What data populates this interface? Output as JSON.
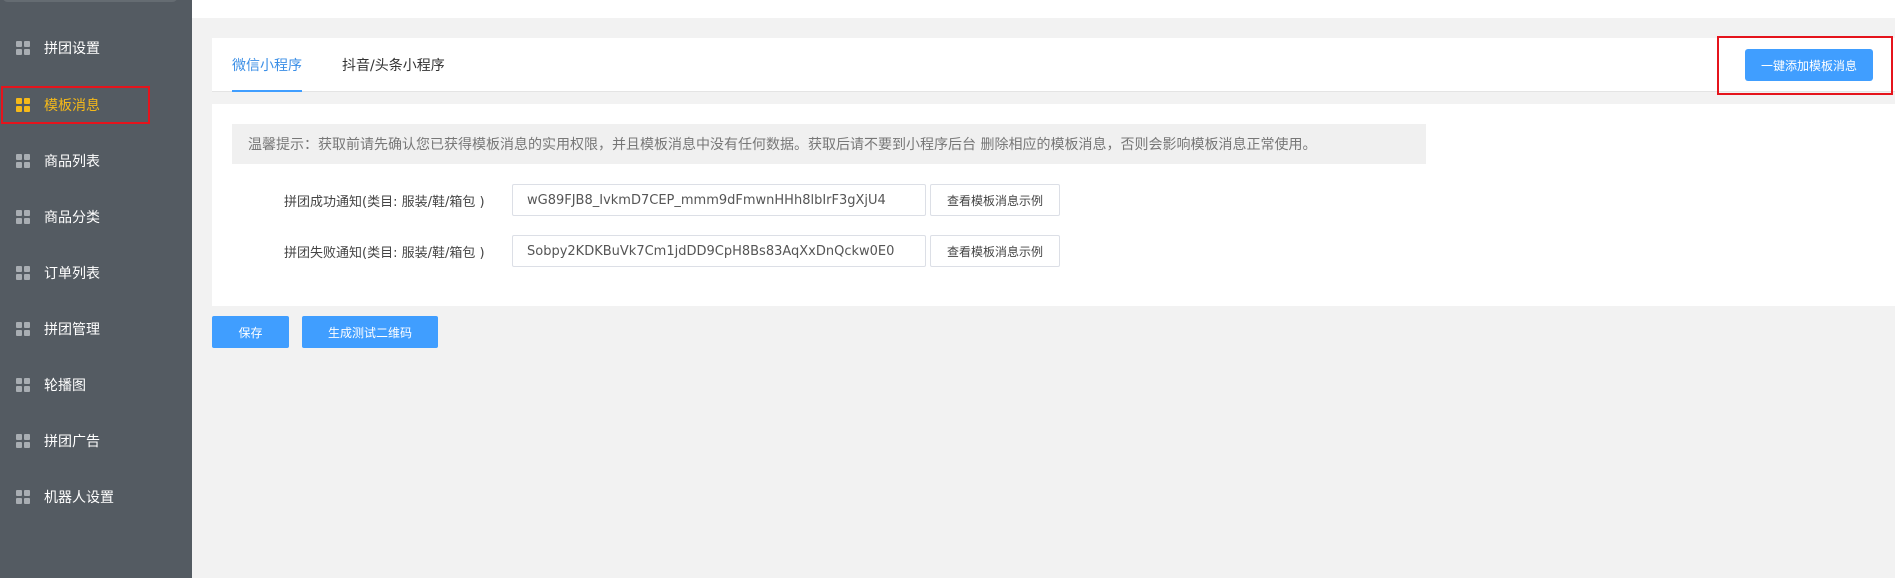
{
  "sidebar": {
    "items": [
      {
        "label": "拼团设置",
        "icon": "grid-icon",
        "active": false
      },
      {
        "label": "模板消息",
        "icon": "grid-icon",
        "active": true
      },
      {
        "label": "商品列表",
        "icon": "grid-icon",
        "active": false
      },
      {
        "label": "商品分类",
        "icon": "grid-icon",
        "active": false
      },
      {
        "label": "订单列表",
        "icon": "grid-icon",
        "active": false
      },
      {
        "label": "拼团管理",
        "icon": "grid-icon",
        "active": false
      },
      {
        "label": "轮播图",
        "icon": "grid-icon",
        "active": false
      },
      {
        "label": "拼团广告",
        "icon": "grid-icon",
        "active": false
      },
      {
        "label": "机器人设置",
        "icon": "grid-icon",
        "active": false
      }
    ]
  },
  "tabs": [
    {
      "label": "微信小程序",
      "active": true
    },
    {
      "label": "抖音/头条小程序",
      "active": false
    }
  ],
  "header": {
    "add_button_label": "一键添加模板消息"
  },
  "tip": {
    "text": "温馨提示：获取前请先确认您已获得模板消息的实用权限，并且模板消息中没有任何数据。获取后请不要到小程序后台 删除相应的模板消息，否则会影响模板消息正常使用。"
  },
  "templates": [
    {
      "label": "拼团成功通知(类目: 服装/鞋/箱包 )",
      "value": "wG89FJB8_IvkmD7CEP_mmm9dFmwnHHh8lbIrF3gXjU4",
      "example_button": "查看模板消息示例"
    },
    {
      "label": "拼团失败通知(类目: 服装/鞋/箱包 )",
      "value": "Sobpy2KDKBuVk7Cm1jdDD9CpH8Bs83AqXxDnQckw0E0",
      "example_button": "查看模板消息示例"
    }
  ],
  "actions": {
    "save_label": "保存",
    "qrcode_label": "生成测试二维码"
  },
  "colors": {
    "sidebar_bg": "#545b62",
    "active_item": "#f5b919",
    "primary": "#409eff",
    "highlight_border": "#e5141c"
  }
}
